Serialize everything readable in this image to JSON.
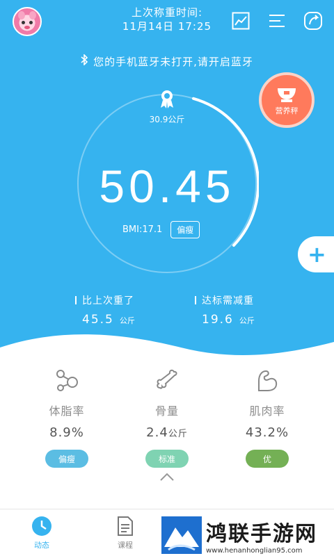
{
  "header": {
    "last_weigh_label": "上次称重时间:",
    "last_weigh_time": "11月14日  17:25"
  },
  "icons": {
    "trend": "chart-trend-icon",
    "menu": "menu-lines-icon",
    "share": "share-icon",
    "bluetooth": "bluetooth-icon"
  },
  "bluetooth_notice": "您的手机蓝牙未打开,请开启蓝牙",
  "scale_button": {
    "label": "营养秤"
  },
  "gauge": {
    "target_weight": "30.9公斤",
    "weight": "50.45",
    "bmi_label": "BMI:17.1",
    "bmi_tag": "偏瘦"
  },
  "compare": {
    "left": {
      "label": "比上次重了",
      "value": "45.5",
      "unit": "公斤"
    },
    "right": {
      "label": "达标需减重",
      "value": "19.6",
      "unit": "公斤"
    }
  },
  "metrics": [
    {
      "name": "体脂率",
      "value": "8.9%",
      "unit": "",
      "badge": "偏瘦",
      "badge_color": "#5bbde3"
    },
    {
      "name": "骨量",
      "value": "2.4",
      "unit": "公斤",
      "badge": "标准",
      "badge_color": "#7fd3b2"
    },
    {
      "name": "肌肉率",
      "value": "43.2%",
      "unit": "",
      "badge": "优",
      "badge_color": "#74b055"
    }
  ],
  "tabs": [
    {
      "label": "动态"
    },
    {
      "label": "课程"
    }
  ],
  "watermark": {
    "name": "鸿联手游网",
    "url": "www.henanhonglian95.com"
  },
  "colors": {
    "primary": "#36b3ef",
    "orange": "#ff7a5c"
  }
}
